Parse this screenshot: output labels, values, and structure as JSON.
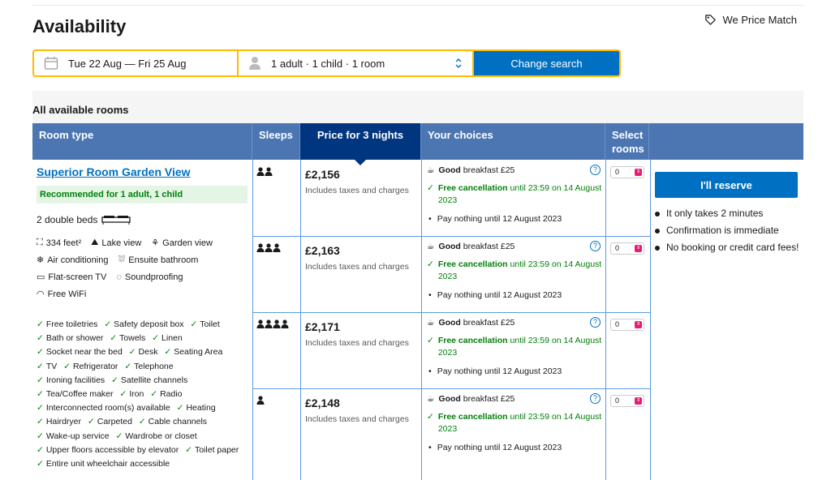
{
  "header": {
    "title": "Availability",
    "price_match": "We Price Match"
  },
  "search": {
    "dates": "Tue 22 Aug — Fri 25 Aug",
    "guests": "1 adult · 1 child · 1 room",
    "button": "Change search"
  },
  "section_title": "All available rooms",
  "table": {
    "headers": [
      "Room type",
      "Sleeps",
      "Price for 3 nights",
      "Your choices",
      "Select rooms"
    ]
  },
  "room": {
    "name": "Superior Room Garden View",
    "recommended": "Recommended for 1 adult, 1 child",
    "beds": "2 double beds",
    "facilities": [
      [
        "334 feet²",
        "Lake view",
        "Garden view"
      ],
      [
        "Air conditioning",
        "Ensuite bathroom"
      ],
      [
        "Flat-screen TV",
        "Soundproofing"
      ],
      [
        "Free WiFi"
      ]
    ],
    "amenities": [
      "Free toiletries",
      "Safety deposit box",
      "Toilet",
      "Bath or shower",
      "Towels",
      "Linen",
      "Socket near the bed",
      "Desk",
      "Seating Area",
      "TV",
      "Refrigerator",
      "Telephone",
      "Ironing facilities",
      "Satellite channels",
      "Tea/Coffee maker",
      "Iron",
      "Radio",
      "Interconnected room(s) available",
      "Heating",
      "Hairdryer",
      "Carpeted",
      "Cable channels",
      "Wake-up service",
      "Wardrobe or closet",
      "Upper floors accessible by elevator",
      "Toilet paper",
      "Entire unit wheelchair accessible"
    ]
  },
  "options": [
    {
      "sleeps": 2,
      "price": "£2,156",
      "tax": "Includes taxes and charges",
      "breakfast_bold": "Good",
      "breakfast": " breakfast £25",
      "cancel_bold": "Free cancellation",
      "cancel": " until 23:59 on 14 August 2023",
      "pay": "Pay nothing until 12 August 2023",
      "qty": "0"
    },
    {
      "sleeps": 3,
      "price": "£2,163",
      "tax": "Includes taxes and charges",
      "breakfast_bold": "Good",
      "breakfast": " breakfast £25",
      "cancel_bold": "Free cancellation",
      "cancel": " until 23:59 on 14 August 2023",
      "pay": "Pay nothing until 12 August 2023",
      "qty": "0"
    },
    {
      "sleeps": 4,
      "price": "£2,171",
      "tax": "Includes taxes and charges",
      "breakfast_bold": "Good",
      "breakfast": " breakfast £25",
      "cancel_bold": "Free cancellation",
      "cancel": " until 23:59 on 14 August 2023",
      "pay": "Pay nothing until 12 August 2023",
      "qty": "0"
    },
    {
      "sleeps": 1,
      "price": "£2,148",
      "tax": "Includes taxes and charges",
      "breakfast_bold": "Good",
      "breakfast": " breakfast £25",
      "cancel_bold": "Free cancellation",
      "cancel": " until 23:59 on 14 August 2023",
      "pay": "Pay nothing until 12 August 2023",
      "qty": "0"
    }
  ],
  "reserve": {
    "button": "I'll reserve",
    "bullets": [
      "It only takes 2 minutes",
      "Confirmation is immediate",
      "No booking or credit card fees!"
    ]
  },
  "colors": {
    "accent": "#0071c2",
    "header": "#4c76b2",
    "header_dark": "#003580",
    "highlight": "#febb02",
    "green": "#008009"
  }
}
